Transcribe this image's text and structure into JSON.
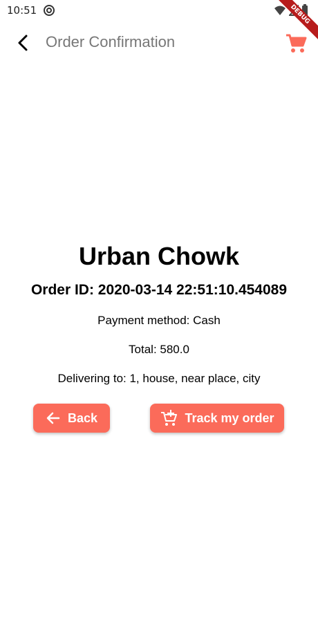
{
  "status_bar": {
    "time": "10:51"
  },
  "debug_banner": {
    "label": "DEBUG"
  },
  "app_bar": {
    "title": "Order Confirmation",
    "back_icon": "arrow-back-icon",
    "cart_icon": "shopping-cart-icon"
  },
  "order": {
    "restaurant": "Urban Chowk",
    "order_id": "Order ID: 2020-03-14 22:51:10.454089",
    "payment": "Payment method: Cash",
    "total": "Total: 580.0",
    "delivery": "Delivering to: 1, house, near place, city"
  },
  "buttons": {
    "back_label": "Back",
    "track_label": "Track my order"
  },
  "colors": {
    "accent": "#fb6b5a",
    "title_gray": "#777777",
    "debug_ribbon": "#b71c1c"
  }
}
